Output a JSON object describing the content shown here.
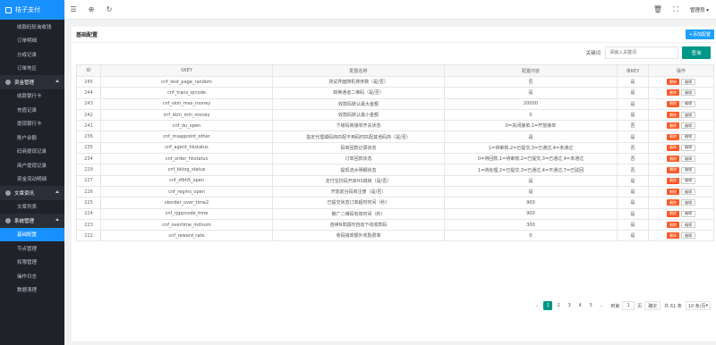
{
  "app": {
    "brand": "桔子支付"
  },
  "sidebar": {
    "items": [
      {
        "label": "收款码轮询收钱",
        "type": "item"
      },
      {
        "label": "订单明细",
        "type": "item"
      },
      {
        "label": "分成记录",
        "type": "item"
      },
      {
        "label": "订单地区",
        "type": "item"
      },
      {
        "label": "资金管理",
        "type": "group"
      },
      {
        "label": "收款银行卡",
        "type": "item"
      },
      {
        "label": "充值记录",
        "type": "item"
      },
      {
        "label": "提现银行卡",
        "type": "item"
      },
      {
        "label": "账户余额",
        "type": "item"
      },
      {
        "label": "码商提现记录",
        "type": "item"
      },
      {
        "label": "商户提现记录",
        "type": "item"
      },
      {
        "label": "资金流动明细",
        "type": "item"
      },
      {
        "label": "文章资讯",
        "type": "group"
      },
      {
        "label": "文章列表",
        "type": "item"
      },
      {
        "label": "系统管理",
        "type": "group"
      },
      {
        "label": "基础配置",
        "type": "item",
        "active": true
      },
      {
        "label": "节点管理",
        "type": "item"
      },
      {
        "label": "权限管理",
        "type": "item"
      },
      {
        "label": "操作日志",
        "type": "item"
      },
      {
        "label": "数据清理",
        "type": "item"
      }
    ]
  },
  "header": {
    "user": "管理员"
  },
  "card": {
    "title": "基础配置",
    "add_label": "+添加配置",
    "search_label": "关键词",
    "search_placeholder": "请输入关键词",
    "search_button": "查询"
  },
  "table": {
    "columns": [
      "ID",
      "SKEY",
      "配置名称",
      "配置内容",
      "单KEY",
      "操作"
    ],
    "rows": [
      {
        "id": "245",
        "skey": "cnf_test_page_random",
        "name": "测试界面随机排序数（是/否）",
        "value": "否",
        "single": "是"
      },
      {
        "id": "244",
        "skey": "cnf_trans_qrcode",
        "name": "转换通道二维码（是/否）",
        "value": "是",
        "single": "是"
      },
      {
        "id": "243",
        "skey": "cnf_skm_max_money",
        "name": "收款码默认最大金额",
        "value": "20000",
        "single": "是"
      },
      {
        "id": "242",
        "skey": "cnf_skm_min_money",
        "name": "收款码默认最小金额",
        "value": "0",
        "single": "是"
      },
      {
        "id": "241",
        "skey": "cnf_du_open",
        "name": "下级码商接单开关状态",
        "value": "0=关闭接单,1=开放接单",
        "single": "否"
      },
      {
        "id": "236",
        "skey": "cnf_msappoint_other",
        "name": "指定代理或码商匹配不到码时匹配其他码商（是/否）",
        "value": "是",
        "single": "是"
      },
      {
        "id": "235",
        "skey": "cnf_agent_hkstatus",
        "name": "码商回款记录状态",
        "value": "1=待审核,2=已提交,3=已通过,4=未通过",
        "single": "否"
      },
      {
        "id": "234",
        "skey": "cnf_order_hkstatus",
        "name": "订单回款状态",
        "value": "0=待回款,1=待审核,2=已提交,3=已通过,4=未通过",
        "single": "否"
      },
      {
        "id": "229",
        "skey": "cnf_bklog_status",
        "name": "提现流水明细状态",
        "value": "1=待处理,2=已提交,3=已通过,4=不通过,7=已驳回",
        "single": "否"
      },
      {
        "id": "227",
        "skey": "cnf_zfbh5_open",
        "name": "支付宝扫码开启H5跳转（是/否）",
        "value": "是",
        "single": "是"
      },
      {
        "id": "226",
        "skey": "cnf_regms_open",
        "name": "开放前台码商注册（是/否）",
        "value": "是",
        "single": "是"
      },
      {
        "id": "225",
        "skey": "skorder_over_time2",
        "name": "已提交状态订单超时时间（秒）",
        "value": "900",
        "single": "是"
      },
      {
        "id": "224",
        "skey": "cnf_rjgqrcode_time",
        "name": "推广二维码有效时间（秒）",
        "value": "900",
        "single": "是"
      },
      {
        "id": "223",
        "skey": "cnf_overtime_mdnum",
        "name": "连续N单超时自动下线收款码",
        "value": "300",
        "single": "是"
      },
      {
        "id": "222",
        "skey": "cnf_reward_rate",
        "name": "收码接单额外奖励费率",
        "value": "0",
        "single": "是"
      }
    ],
    "delete_label": "删除",
    "edit_label": "编辑"
  },
  "pager": {
    "pages": [
      "1",
      "2",
      "3",
      "4",
      "5"
    ],
    "current": "1",
    "goto_label": "到第",
    "goto_value": "1",
    "page_unit": "页",
    "confirm_label": "确定",
    "total_label": "共 61 条",
    "page_size_label": "10 条/页"
  }
}
